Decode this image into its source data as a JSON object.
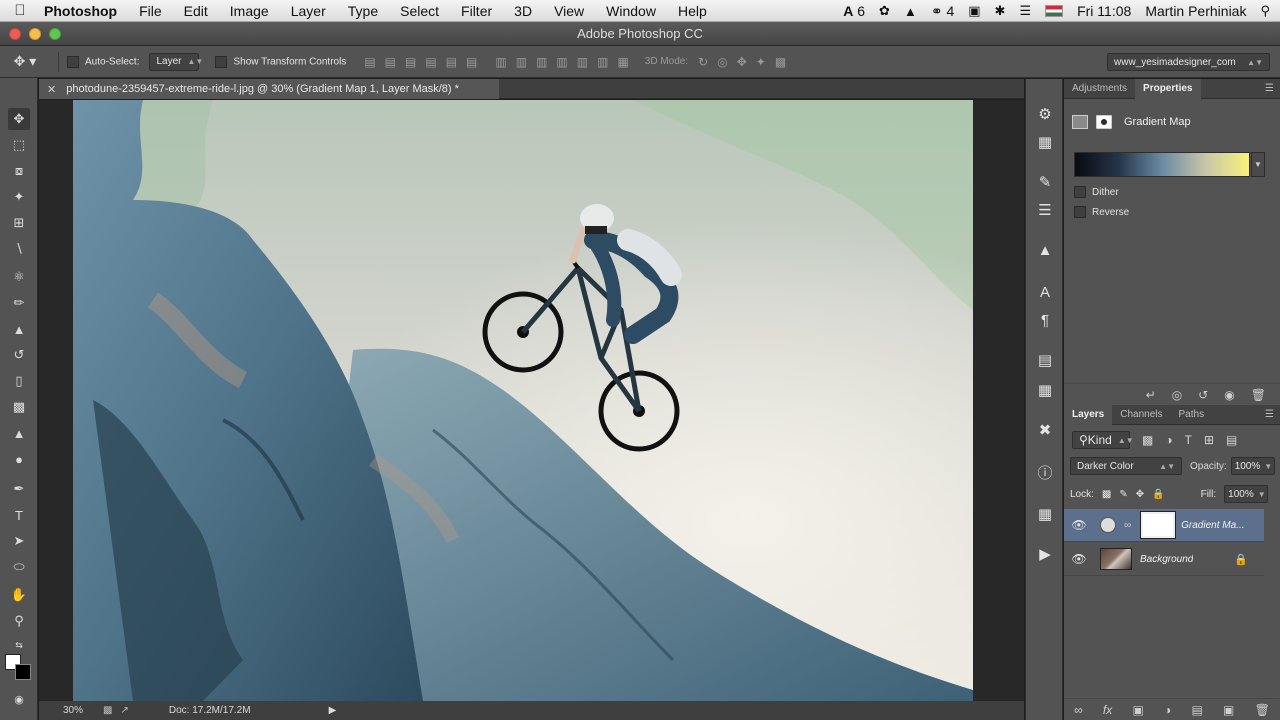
{
  "menubar": {
    "app_name": "Photoshop",
    "items": [
      "File",
      "Edit",
      "Image",
      "Layer",
      "Type",
      "Select",
      "Filter",
      "3D",
      "View",
      "Window",
      "Help"
    ],
    "status": {
      "adobe_count": "6",
      "cc_count": "4",
      "clock": "Fri 11:08",
      "user": "Martin Perhiniak"
    }
  },
  "titlebar": {
    "title": "Adobe Photoshop CC"
  },
  "options": {
    "auto_select_label": "Auto-Select:",
    "auto_select_value": "Layer",
    "show_transform_label": "Show Transform Controls",
    "mode_3d_label": "3D Mode:",
    "workspace": "www_yesimadesigner_com"
  },
  "document": {
    "tab_title": "photodune-2359457-extreme-ride-l.jpg @ 30% (Gradient Map 1, Layer Mask/8) *",
    "zoom": "30%",
    "doc_info": "Doc: 17.2M/17.2M"
  },
  "properties_panel": {
    "tabs": [
      "Adjustments",
      "Properties"
    ],
    "active_tab": "Properties",
    "title": "Gradient Map",
    "dither_label": "Dither",
    "reverse_label": "Reverse",
    "gradient_colors": [
      "#0a0a12",
      "#253549",
      "#6b8aa3",
      "#c8c6a8",
      "#f8f17a"
    ]
  },
  "layers_panel": {
    "tabs": [
      "Layers",
      "Channels",
      "Paths"
    ],
    "active_tab": "Layers",
    "filter_label": "Kind",
    "blend_mode": "Darker Color",
    "opacity_label": "Opacity:",
    "opacity_value": "100%",
    "lock_label": "Lock:",
    "fill_label": "Fill:",
    "fill_value": "100%",
    "layers": [
      {
        "name": "Gradient Ma...",
        "selected": true
      },
      {
        "name": "Background",
        "selected": false
      }
    ]
  },
  "colors": {
    "ui_dark": "#535353",
    "selection": "#5c6f8c"
  }
}
